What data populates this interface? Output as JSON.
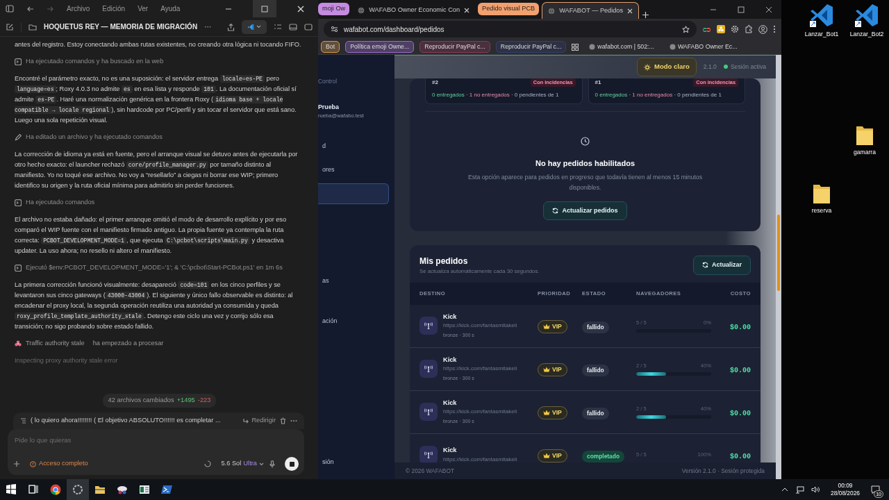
{
  "codex": {
    "menu": [
      "Archivo",
      "Edición",
      "Ver",
      "Ayuda"
    ],
    "title": "HOQUETUS REY — MEMORIA DE MIGRACIÓN",
    "title_more": "···",
    "feed": [
      {
        "kind": "para",
        "segments": [
          {
            "kind": "text",
            "text": "antes del registro. Estoy conectando ambas rutas existentes, no creando otra lógica ni tocando FIFO."
          }
        ]
      },
      {
        "kind": "command",
        "text": "Ha ejecutado comandos y ha buscado en la web"
      },
      {
        "kind": "para",
        "segments": [
          {
            "kind": "text",
            "text": "Encontré el parámetro exacto, no es una suposición: el servidor entrega "
          },
          {
            "kind": "code",
            "text": "locale=es-PE"
          },
          {
            "kind": "text",
            "text": " pero "
          },
          {
            "kind": "code",
            "text": "language=es"
          },
          {
            "kind": "text",
            "text": "; Roxy 4.0.3 no admite "
          },
          {
            "kind": "code",
            "text": "es"
          },
          {
            "kind": "text",
            "text": " en esa lista y responde "
          },
          {
            "kind": "code",
            "text": "101"
          },
          {
            "kind": "text",
            "text": ". La documentación oficial sí admite "
          },
          {
            "kind": "code",
            "text": "es-PE"
          },
          {
            "kind": "text",
            "text": ". Haré una normalización genérica en la frontera Roxy ("
          },
          {
            "kind": "code",
            "text": "idioma base + locale compatible → locale regional"
          },
          {
            "kind": "text",
            "text": "), sin hardcode por PC/perfil y sin tocar el servidor que está sano. Luego una sola repetición visual."
          }
        ]
      },
      {
        "kind": "edit",
        "text": "Ha editado un archivo y ha ejecutado comandos"
      },
      {
        "kind": "para",
        "segments": [
          {
            "kind": "text",
            "text": "La corrección de idioma ya está en fuente, pero el arranque visual se detuvo antes de ejecutarla por otro hecho exacto: el launcher rechazó "
          },
          {
            "kind": "code",
            "text": "core/profile_manager.py"
          },
          {
            "kind": "text",
            "text": " por tamaño distinto al manifiesto. Yo no toqué ese archivo. No voy a “resellarlo” a ciegas ni borrar ese WIP; primero identifico su origen y la ruta oficial mínima para admitirlo sin perder funciones."
          }
        ]
      },
      {
        "kind": "command",
        "text": "Ha ejecutado comandos"
      },
      {
        "kind": "para",
        "segments": [
          {
            "kind": "text",
            "text": "El archivo no estaba dañado: el primer arranque omitió el modo de desarrollo explícito y por eso comparó el WIP fuente con el manifiesto firmado antiguo. La propia fuente ya contempla la ruta correcta: "
          },
          {
            "kind": "code",
            "text": "PCBOT_DEVELOPMENT_MODE=1"
          },
          {
            "kind": "text",
            "text": ", que ejecuta "
          },
          {
            "kind": "code",
            "text": "C:\\pcbot\\scripts\\main.py"
          },
          {
            "kind": "text",
            "text": " y desactiva updater. La uso ahora; no resello ni altero el manifiesto."
          }
        ]
      },
      {
        "kind": "command",
        "text": "Ejecutó $env:PCBOT_DEVELOPMENT_MODE='1'; & 'C:\\pcbot\\Start-PCBot.ps1' en 1m 6s"
      },
      {
        "kind": "para",
        "segments": [
          {
            "kind": "text",
            "text": "La primera corrección funcionó visualmente: desapareció "
          },
          {
            "kind": "code",
            "text": "code=101"
          },
          {
            "kind": "text",
            "text": " en los cinco perfiles y se levantaron sus cinco gateways ("
          },
          {
            "kind": "code",
            "text": "43000-43004"
          },
          {
            "kind": "text",
            "text": "). El siguiente y único fallo observable es distinto: al encadenar el proxy local, la segunda operación reutiliza una autoridad ya consumida y queda "
          },
          {
            "kind": "code",
            "text": "roxy_profile_template_authority_stale"
          },
          {
            "kind": "text",
            "text": ". Detengo este ciclo una vez y corrijo sólo esa transición; no sigo probando sobre estado fallido."
          }
        ]
      }
    ],
    "task": {
      "label": "Traffic authority stale",
      "status": "ha empezado a procesar"
    },
    "activity": "Inspecting proxy authority stale error",
    "changes": {
      "label": "42 archivos cambiados",
      "added": "+1495",
      "removed": "-223"
    },
    "queued": {
      "text": "( lo quiero ahora!!!!!!!! ( El objetivo ABSOLUTO!!!!!! es  completar ...",
      "action": "Redirigir"
    },
    "composer": {
      "placeholder": "Pide lo que quieras",
      "access": "Acceso completo",
      "model": "5.6 Sol",
      "effort": "Ultra"
    }
  },
  "browser": {
    "tabs": [
      {
        "kind": "group",
        "label": "moji Ow",
        "color": "#c58be0"
      },
      {
        "kind": "tab",
        "label": "WAFABO Owner Economic Con",
        "selected": false
      },
      {
        "kind": "group",
        "label": "Pedido visual PCB",
        "color": "#f2a06e"
      },
      {
        "kind": "tab",
        "label": "WAFABOT — Pedidos",
        "selected": true
      }
    ],
    "url": "wafabot.com/dashboard/pedidos",
    "bookmarks": [
      {
        "kind": "group",
        "label": "Bot",
        "color": "#d89a4a"
      },
      {
        "kind": "group",
        "label": "Política emoji Owne...",
        "color": "#9a6ad0"
      },
      {
        "kind": "group",
        "label": "Reproducir PayPal c...",
        "color": "#8a3a58"
      },
      {
        "kind": "group",
        "label": "Reproducir PayPal c...",
        "color": "#34406a"
      },
      {
        "kind": "apps"
      },
      {
        "kind": "link",
        "label": "wafabot.com | 502:..."
      },
      {
        "kind": "link",
        "label": "WAFABO Owner Ec..."
      }
    ]
  },
  "app": {
    "sidebar": {
      "section": "Control",
      "user_name": "Prueba",
      "user_email": "rueba@wafabo.test",
      "items": [
        {
          "label": "d",
          "selected": false
        },
        {
          "label": "ores",
          "selected": false
        },
        {
          "selected": true
        },
        {
          "label": "as",
          "selected": false
        },
        {
          "label": "ación",
          "selected": false
        }
      ],
      "logout": "sión"
    },
    "topbar": {
      "theme_button": "Modo claro",
      "version": "2.1.0",
      "session": "Sesión activa"
    },
    "batches": [
      {
        "id": "#2",
        "badge": "Con incidencias",
        "delivered": "0 entregados",
        "failed": "· 1 no entregados",
        "pending": "· 0 pendientes de 1"
      },
      {
        "id": "#1",
        "badge": "Con incidencias",
        "delivered": "0 entregados",
        "failed": "· 1 no entregados",
        "pending": "· 0 pendientes de 1"
      }
    ],
    "empty": {
      "title": "No hay pedidos habilitados",
      "text": "Esta opción aparece para pedidos en progreso que todavía tienen al menos 15 minutos disponibles.",
      "button": "Actualizar pedidos"
    },
    "orders": {
      "title": "Mis pedidos",
      "subtitle": "Se actualiza automáticamente cada 30 segundos.",
      "refresh": "Actualizar",
      "columns": [
        "DESTINO",
        "PRIORIDAD",
        "ESTADO",
        "NAVEGADORES",
        "COSTO"
      ],
      "rows": [
        {
          "name": "Kick",
          "url": "https://kick.com/fantasmitakeli",
          "meta": "bronze · 300 s",
          "priority": "VIP",
          "status": "fallido",
          "completed": false,
          "browsers": "5 / 5",
          "percent": "0%",
          "level": 0,
          "cost": "$0.00"
        },
        {
          "name": "Kick",
          "url": "https://kick.com/fantasmitakeli",
          "meta": "bronze · 300 s",
          "priority": "VIP",
          "status": "fallido",
          "completed": false,
          "browsers": "2 / 5",
          "percent": "40%",
          "level": 0.4,
          "cost": "$0.00"
        },
        {
          "name": "Kick",
          "url": "https://kick.com/fantasmitakeli",
          "meta": "bronze · 300 s",
          "priority": "VIP",
          "status": "fallido",
          "completed": false,
          "browsers": "2 / 5",
          "percent": "40%",
          "level": 0.4,
          "cost": "$0.00"
        },
        {
          "name": "Kick",
          "url": "https://kick.com/fantasmitakeli",
          "priority": "VIP",
          "status": "completado",
          "completed": true,
          "browsers": "5 / 5",
          "percent": "100%",
          "cost": "$0.00"
        }
      ]
    },
    "footer": {
      "copyright": "© 2026 WAFABOT",
      "version": "Versión 2.1.0 · Sesión protegida"
    }
  },
  "desktop_icons": [
    {
      "kind": "vscode",
      "label": "Lanzar_Bot1"
    },
    {
      "kind": "vscode",
      "label": "Lanzar_Bot2"
    },
    {
      "kind": "folder",
      "label": "gamarra"
    },
    {
      "kind": "folder",
      "label": "reserva"
    }
  ],
  "taskbar": {
    "apps": [
      {
        "kind": "start"
      },
      {
        "kind": "taskview"
      },
      {
        "kind": "chrome"
      },
      {
        "kind": "codex"
      },
      {
        "kind": "explorer"
      },
      {
        "kind": "tool"
      },
      {
        "kind": "sheet"
      },
      {
        "kind": "powershell"
      }
    ],
    "time": "00:09",
    "date": "28/08/2026",
    "notifications": "10"
  }
}
